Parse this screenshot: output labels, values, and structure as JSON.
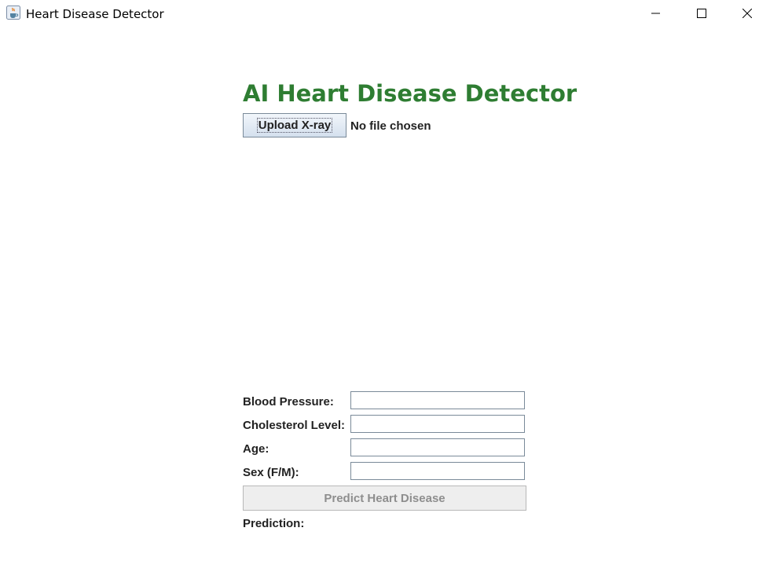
{
  "window": {
    "title": "Heart Disease Detector",
    "icon": "java-cup-icon",
    "controls": [
      "minimize-icon",
      "maximize-icon",
      "close-icon"
    ]
  },
  "main": {
    "heading": "AI Heart Disease Detector",
    "heading_color": "#2e7d32",
    "upload_button_label": "Upload X-ray",
    "file_status": "No file chosen",
    "fields": [
      {
        "label": "Blood Pressure:",
        "value": ""
      },
      {
        "label": "Cholesterol Level:",
        "value": ""
      },
      {
        "label": "Age:",
        "value": ""
      },
      {
        "label": "Sex (F/M):",
        "value": ""
      }
    ],
    "predict_button_label": "Predict Heart Disease",
    "predict_button_enabled": false,
    "prediction_label": "Prediction:",
    "prediction_value": ""
  }
}
